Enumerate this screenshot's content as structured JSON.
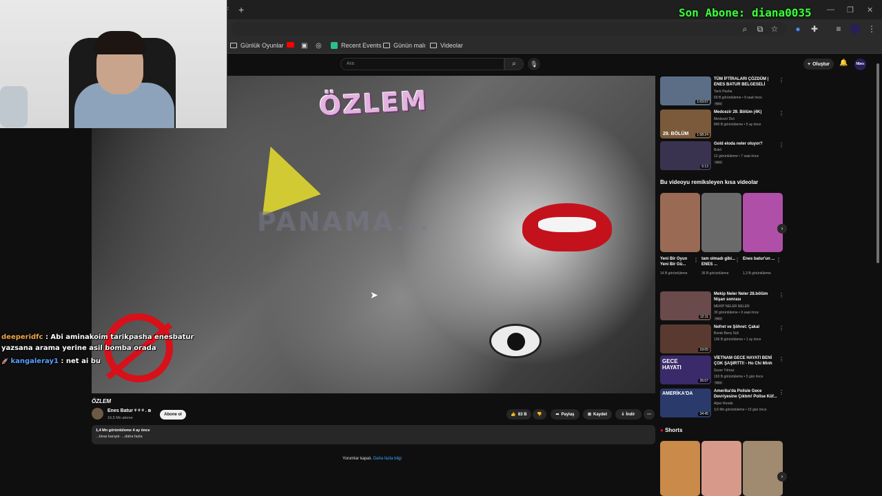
{
  "overlay": {
    "subscriber_banner": "Son Abone: diana0035"
  },
  "browser": {
    "new_tab": "+",
    "tab_close": "×",
    "bookmarks": [
      {
        "label": "Günlük Oyunlar",
        "icon": "folder-icon"
      },
      {
        "label": "",
        "icon": "youtube-icon"
      },
      {
        "label": "",
        "icon": "gallery-icon"
      },
      {
        "label": "",
        "icon": "globe-icon"
      },
      {
        "label": "Recent Events",
        "icon": "recent-events-icon"
      },
      {
        "label": "Günün malı",
        "icon": "folder-icon"
      },
      {
        "label": "Videolar",
        "icon": "folder-icon"
      }
    ]
  },
  "header": {
    "search_placeholder": "Ara",
    "create_label": "Oluştur",
    "avatar_text": "Nbec"
  },
  "player": {
    "title_art": "ÖZLEM",
    "ghost_text": "PANAMA..."
  },
  "chat": [
    {
      "user": "deeperidfc",
      "msg": ": Abi aminakoim tarikpasha enesbatur"
    },
    {
      "user": "",
      "msg": "yazsana arama yerine asil bomba orada"
    },
    {
      "user": "kangaleray1",
      "msg": ": net ai bu"
    }
  ],
  "video": {
    "title": "ÖZLEM",
    "channel": "Enes Batur ᵠ ᵠ ᵠ . ᴃ",
    "subscribers": "16,5 Mn abone",
    "subscribe_label": "Abone ol",
    "likes": "83 B",
    "share_label": "Paylaş",
    "save_label": "Kaydet",
    "download_label": "İndir",
    "stats": "1,4 Mn görüntüleme  4 ay önce",
    "desc_preview": "...biraz karışık-  ...daha fazla",
    "comments_off": "Yorumlar kapalı.",
    "more_info": "Daha fazla bilgi"
  },
  "sidebar": {
    "recs_top": [
      {
        "title": "TÜM İFTİRALARI ÇÖZDÜM | ENES BATUR BELGESELİ",
        "channel": "Tarık Pasha",
        "meta": "69 B görüntüleme • 9 saat önce",
        "badge": "Yeni",
        "duration": "1:03:07",
        "color": "#5b6e86"
      },
      {
        "title": "Medcezir 29. Bölüm (4K)",
        "channel": "Medcezir Dizi",
        "meta": "840 B görüntüleme • 5 ay önce",
        "badge": "",
        "duration": "1:58:24",
        "color": "#7a5a3a",
        "thumb_text": "29. BÖLÜM"
      },
      {
        "title": "Gold eloda neler oluyor?",
        "channel": "Bskrl",
        "meta": "12 görüntüleme • 7 saat önce",
        "badge": "Yeni",
        "duration": "6:13",
        "color": "#3a3350"
      }
    ],
    "remix_title": "Bu videoyu remiksleyen kısa videolar",
    "remix_shorts": [
      {
        "title": "Yeni Bir Oyun Yeni Bir Gü...",
        "views": "14 B görüntüleme",
        "color": "#9a6a55"
      },
      {
        "title": "tam olmadı gibi... ENES ...",
        "views": "36 B görüntüleme",
        "color": "#6a6a6a"
      },
      {
        "title": "Enes batur'un ...",
        "views": "1,3 B görüntüleme",
        "color": "#b04fa8"
      }
    ],
    "recs_bottom": [
      {
        "title": "Mekip Neler Neler 28.bölüm Nişan sonrası",
        "channel": "MEKİP NELER NELER",
        "meta": "30 görüntüleme • 9 saat önce",
        "badge": "Yeni",
        "duration": "12:11",
        "color": "#6a4a4a"
      },
      {
        "title": "Nefret ve Şöhret: Çakal",
        "channel": "Burak Barış Süli",
        "meta": "136 B görüntüleme • 1 ay önce",
        "badge": "",
        "duration": "19:05",
        "color": "#5a3a30"
      },
      {
        "title": "VİETNAM GECE HAYATI BENİ ÇOK ŞAŞIRTTI! - Ho Chi Minh",
        "channel": "Sezer Yılmaz",
        "meta": "193 B görüntüleme • 5 gün önce",
        "badge": "Yeni",
        "duration": "26:07",
        "color": "#3a2a6a",
        "thumb_text": "GECE HAYATI"
      },
      {
        "title": "Amerika'da Polisle Gece Devriyesine Çıktım! Polise Küf...",
        "channel": "Alper Rende",
        "meta": "3,6 Mn görüntüleme • 10 gün önce",
        "badge": "",
        "duration": "34:45",
        "color": "#2a3a6a",
        "thumb_text": "AMERİKA'DA"
      }
    ],
    "shorts_title": "Shorts"
  }
}
